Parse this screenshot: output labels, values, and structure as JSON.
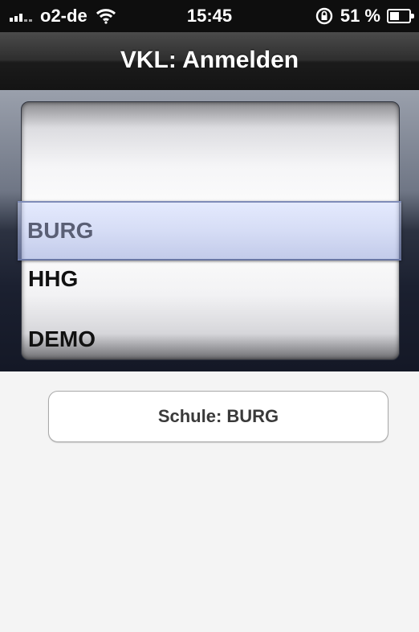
{
  "status_bar": {
    "carrier": "o2-de",
    "time": "15:45",
    "battery_percent": "51 %",
    "battery_level": 0.51
  },
  "navbar": {
    "title": "VKL: Anmelden"
  },
  "picker": {
    "selected": "BURG",
    "items": [
      "BURG",
      "HHG",
      "DEMO"
    ]
  },
  "school_button": {
    "label": "Schule: BURG"
  },
  "colors": {
    "navbar": "#1b1b1b",
    "selection": "#aab4e0",
    "background": "#f4f4f4"
  }
}
